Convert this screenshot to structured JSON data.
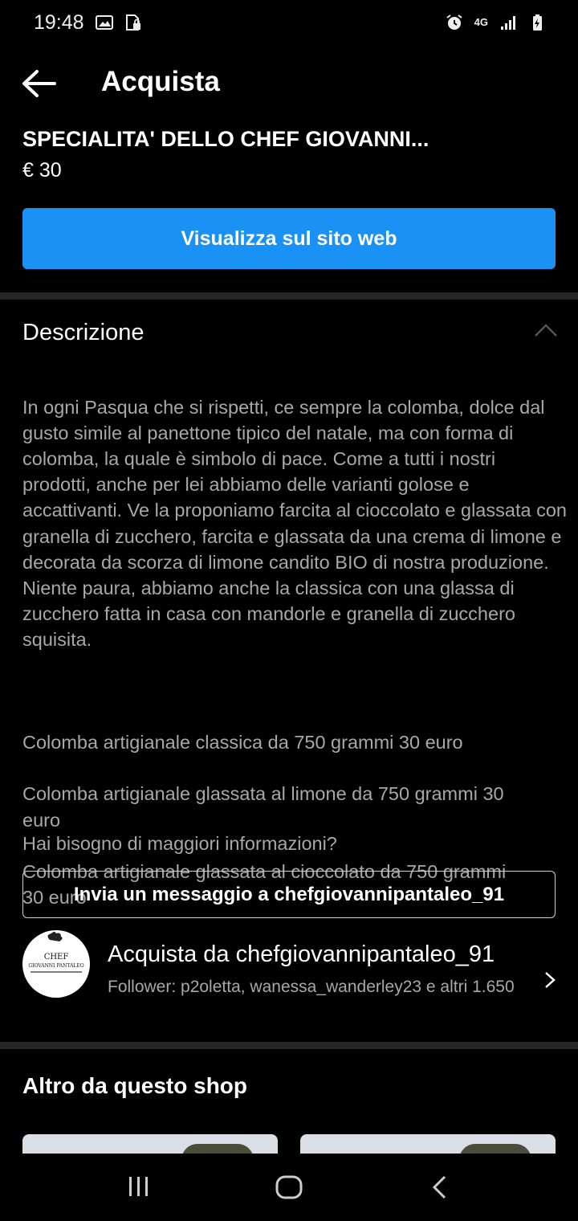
{
  "status_bar": {
    "time": "19:48",
    "icons_left": [
      "image-icon",
      "sim-lock-icon"
    ],
    "icons_right": [
      "alarm-icon",
      "4g-icon",
      "signal-icon",
      "battery-charging-icon"
    ],
    "network": "4G"
  },
  "header": {
    "title": "Acquista",
    "back_icon": "arrow-left-icon"
  },
  "product": {
    "title": "SPECIALITA' DELLO CHEF GIOVANNI...",
    "price": "€ 30",
    "web_button_label": "Visualizza sul sito web"
  },
  "description": {
    "header": "Descrizione",
    "collapse_icon": "chevron-up-icon",
    "paragraph_1": "In ogni Pasqua che si rispetti, ce sempre la colomba, dolce dal gusto simile al panettone  tipico del natale, ma con forma di colomba, la quale è simbolo di pace. Come a tutti i nostri prodotti, anche per lei abbiamo delle varianti golose e accattivanti. Ve la proponiamo farcita al cioccolato e glassata con granella di zucchero, farcita e glassata da una crema di limone e decorata da scorza di limone candito BIO di nostra produzione. Niente paura, abbiamo anche la classica con una glassa di zucchero fatta in casa con mandorle e granella di zucchero squisita.",
    "variants": [
      "Colomba artigianale classica da 750 grammi 30 euro",
      "Colomba artigianale  glassata al limone da 750 grammi 30 euro",
      "Colomba artigianale glassata al cioccolato da 750 grammi 30 euro"
    ],
    "info_question": "Hai bisogno di maggiori informazioni?",
    "message_button_label": "Invia un messaggio a chefgiovannipantaleo_91"
  },
  "shop": {
    "name": "Acquista da chefgiovannipantaleo_91",
    "followers": "Follower: p2oletta, wanessa_wanderley23 e altri 1.650",
    "avatar_text": "CHEF",
    "avatar_subtext": "GIOVANNI PANTALEO",
    "chevron_icon": "chevron-right-icon"
  },
  "more_from_shop": {
    "title": "Altro da questo shop"
  },
  "nav_bar": {
    "recents_icon": "recents-icon",
    "home_icon": "home-icon",
    "back_icon": "back-icon"
  },
  "colors": {
    "background": "#000000",
    "accent": "#1a91f5",
    "secondary_text": "#a8a8a8",
    "divider": "#262626"
  }
}
